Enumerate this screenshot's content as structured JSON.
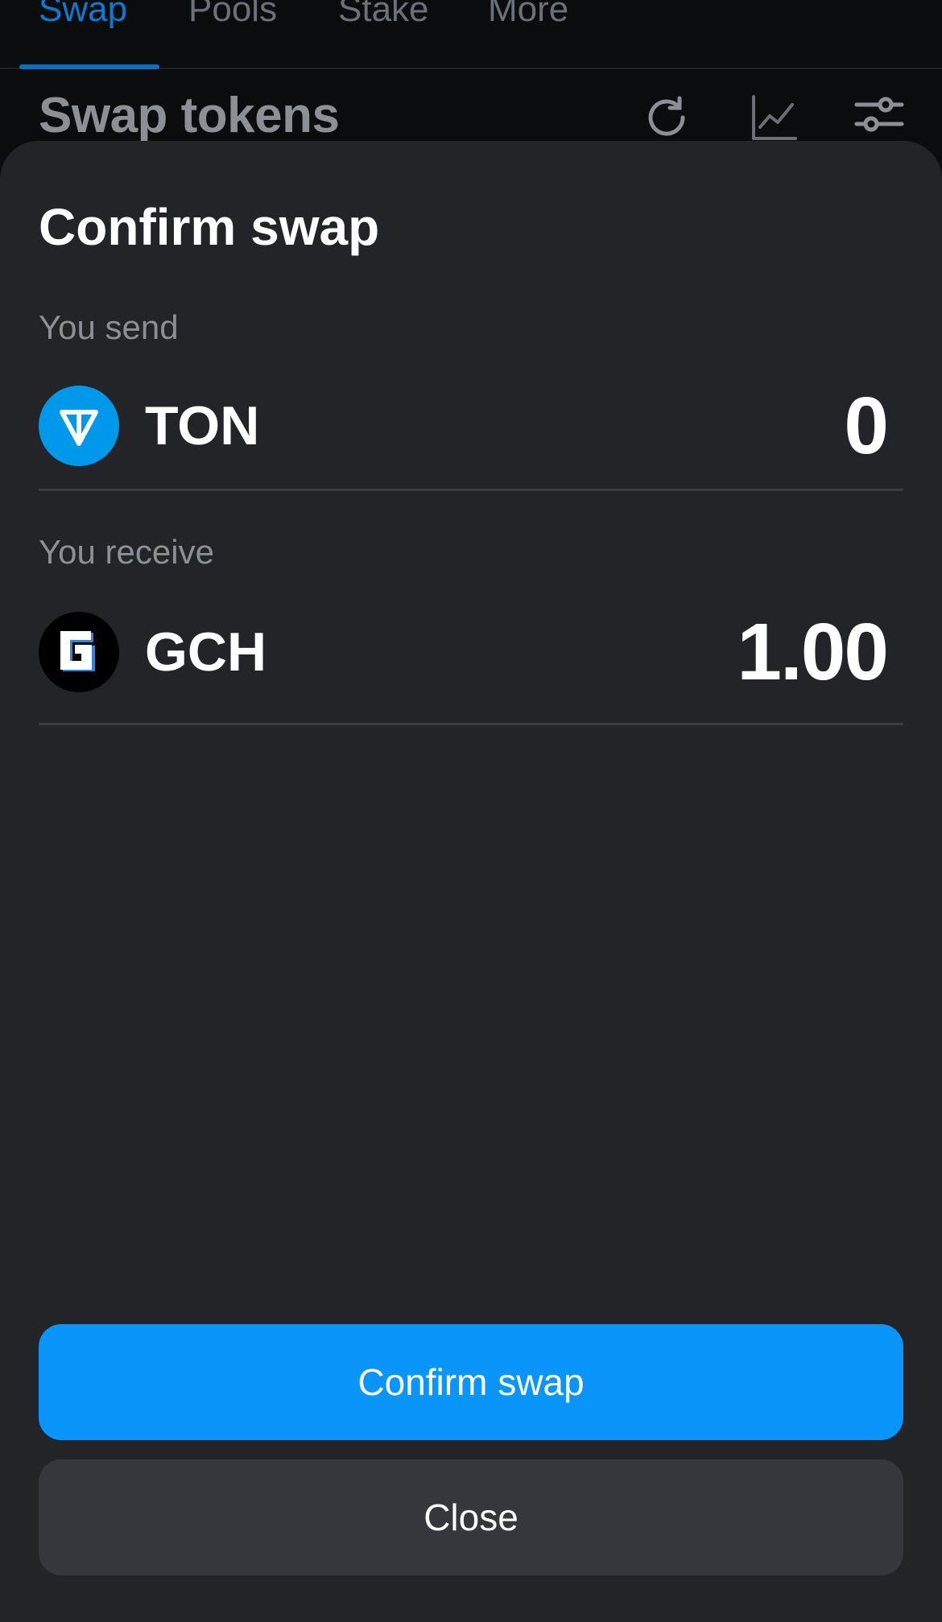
{
  "nav": {
    "tabs": [
      {
        "label": "Swap",
        "active": true
      },
      {
        "label": "Pools",
        "active": false
      },
      {
        "label": "Stake",
        "active": false
      },
      {
        "label": "More",
        "active": false
      }
    ]
  },
  "header": {
    "title": "Swap tokens",
    "icons": [
      "refresh-icon",
      "chart-icon",
      "settings-sliders-icon"
    ]
  },
  "modal": {
    "title": "Confirm swap",
    "send": {
      "label": "You send",
      "token": "TON",
      "amount": "0",
      "icon": "ton-icon"
    },
    "receive": {
      "label": "You receive",
      "token": "GCH",
      "amount": "1.00",
      "icon": "gch-icon"
    },
    "confirm_label": "Confirm swap",
    "close_label": "Close"
  },
  "colors": {
    "accent": "#0a95fb",
    "sheet_bg": "#222428",
    "ton_blue": "#0098ea"
  }
}
